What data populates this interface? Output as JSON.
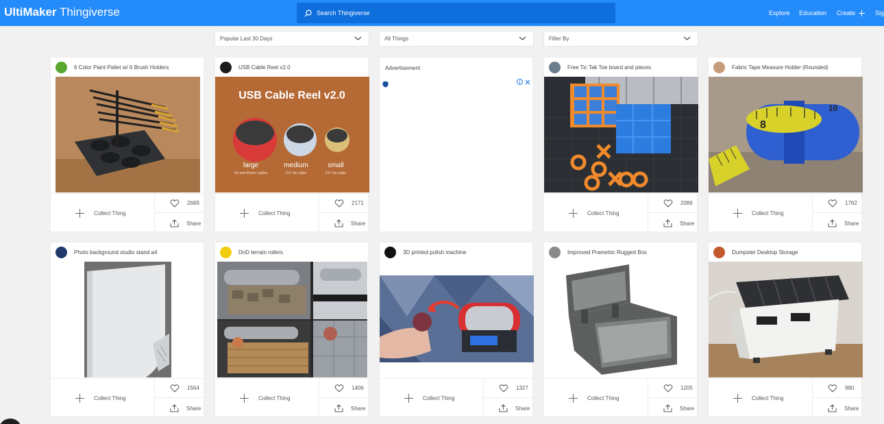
{
  "header": {
    "logo_bold": "UltiMaker",
    "logo_light": "Thingiverse",
    "search_placeholder": "Search Thingiverse",
    "nav": [
      "Explore",
      "Education",
      "Create",
      "Sig"
    ],
    "brand_color": "#248bfb"
  },
  "filters": {
    "sort": "Popular Last 30 Days",
    "type": "All Things",
    "filter": "Filter By"
  },
  "ad": {
    "label": "Advertisement"
  },
  "actions": {
    "collect": "Collect Thing",
    "share": "Share"
  },
  "cards": [
    {
      "title": "6 Color Paint Pallet w/ 6 Brush Holders",
      "likes": "2689",
      "avatar_color": "#5aa832",
      "image": "paint-pallet"
    },
    {
      "title": "USB Cable Reel v2.0",
      "likes": "2171",
      "avatar_color": "#1b1b1b",
      "image": "usb-cable-reel",
      "image_text": {
        "heading": "USB Cable Reel v2.0",
        "sizes": [
          "large",
          "medium",
          "small"
        ],
        "notes": [
          "2m and thicker cables",
          "0.5~2m cable",
          "0.5~1m cable"
        ]
      }
    },
    {
      "title": "Free Tic Tak Toe board and pieces",
      "likes": "2086",
      "avatar_color": "#6b7d8c",
      "image": "tic-tac-toe"
    },
    {
      "title": "Fabric Tape Measure Holder (Rounded)",
      "likes": "1762",
      "avatar_color": "#c89b7b",
      "image": "tape-measure"
    },
    {
      "title": "Photo background studio stand a4",
      "likes": "1564",
      "avatar_color": "#1f3a6b",
      "image": "photo-stand"
    },
    {
      "title": "DnD terrain rollers",
      "likes": "1406",
      "avatar_color": "#f2cc0f",
      "image": "terrain-rollers"
    },
    {
      "title": "3D printed polish machine",
      "likes": "1327",
      "avatar_color": "#111111",
      "image": "polish-machine"
    },
    {
      "title": "Improved Prametric Rugged Box",
      "likes": "1205",
      "avatar_color": "#8a8a8a",
      "image": "rugged-box"
    },
    {
      "title": "Dumpster Desktop Storage",
      "likes": "980",
      "avatar_color": "#c25a2e",
      "image": "dumpster"
    }
  ]
}
